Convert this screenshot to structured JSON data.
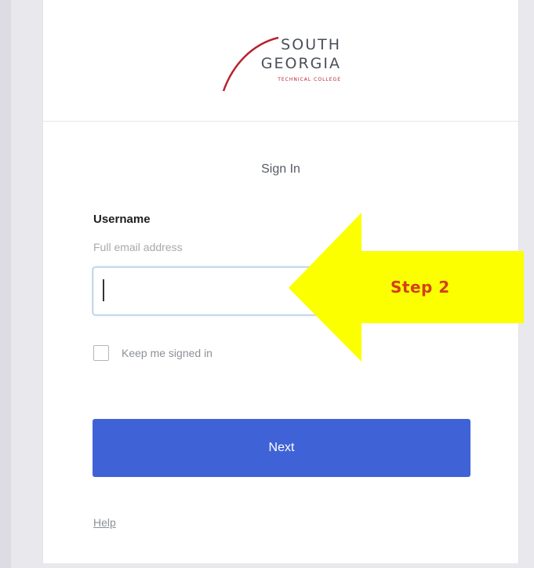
{
  "logo": {
    "line1": "SOUTH",
    "line2": "GEORGIA",
    "subtitle": "TECHNICAL COLLEGE",
    "accent_color": "#b8232f"
  },
  "form": {
    "title": "Sign In",
    "username_label": "Username",
    "username_hint": "Full email address",
    "username_value": "",
    "keep_signed_in_label": "Keep me signed in",
    "keep_signed_in_checked": false,
    "next_label": "Next",
    "help_label": "Help",
    "button_color": "#3f63d6"
  },
  "annotation": {
    "label": "Step 2",
    "arrow_color": "#fbff00",
    "label_color": "#d2401b",
    "direction": "left"
  }
}
